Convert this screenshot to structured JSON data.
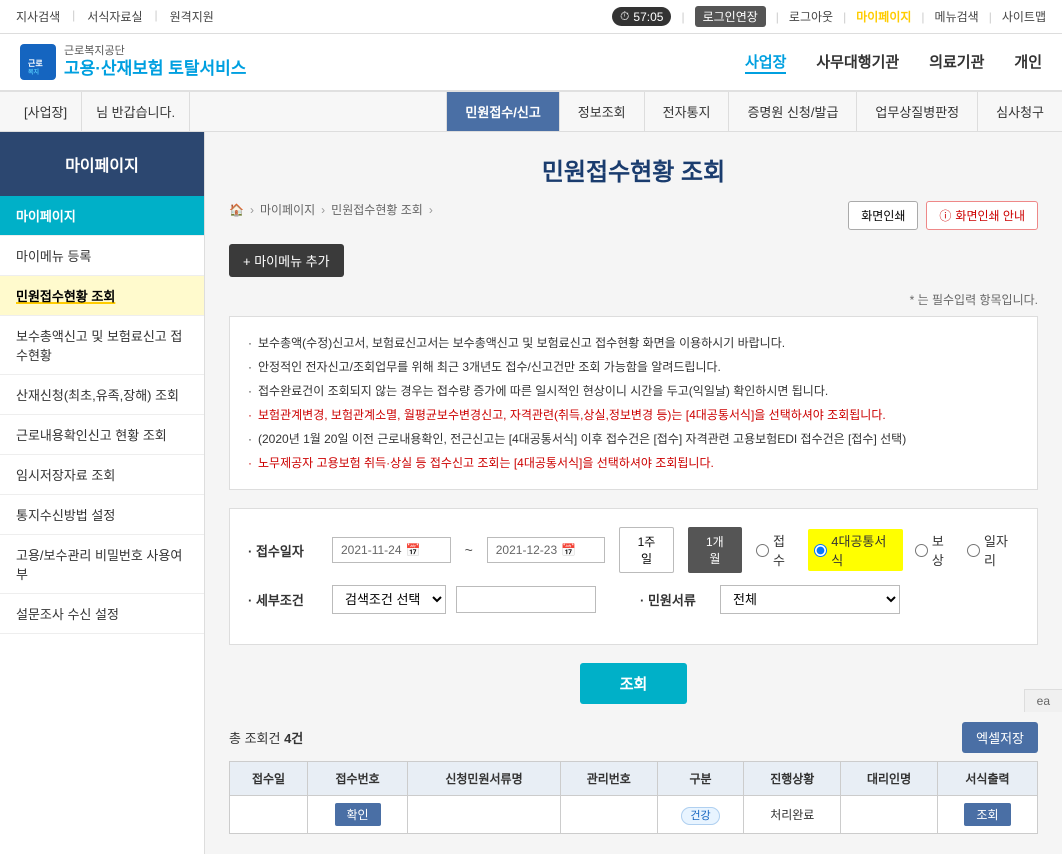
{
  "topNav": {
    "leftLinks": [
      "지사검색",
      "서식자료실",
      "원격지원"
    ],
    "timer": "57:05",
    "loginExtend": "로그인연장",
    "logout": "로그아웃",
    "mypage": "마이페이지",
    "menuSearch": "메뉴검색",
    "sitemap": "사이트맵"
  },
  "header": {
    "orgName": "근로복지공단",
    "serviceNamePart1": "고용·산재보험",
    "serviceNamePart2": "토탈서비스",
    "navItems": [
      {
        "label": "사업장",
        "active": true
      },
      {
        "label": "사무대행기관"
      },
      {
        "label": "의료기관"
      },
      {
        "label": "개인"
      }
    ]
  },
  "tabBar": {
    "label": "[사업장]",
    "user": "님 반갑습니다.",
    "tabs": [
      {
        "label": "민원접수/신고",
        "active": true
      },
      {
        "label": "정보조회"
      },
      {
        "label": "전자통지"
      },
      {
        "label": "증명원 신청/발급"
      },
      {
        "label": "업무상질병판정"
      },
      {
        "label": "심사청구"
      }
    ]
  },
  "sidebar": {
    "title": "마이페이지",
    "menuItems": [
      {
        "label": "마이페이지",
        "active": true,
        "id": "mypage"
      },
      {
        "label": "마이메뉴 등록",
        "id": "mymenu-reg"
      },
      {
        "label": "민원접수현황 조회",
        "id": "complaint-status",
        "highlight": true
      },
      {
        "label": "보수총액신고 및 보험료신고 접수현황",
        "id": "salary-report"
      },
      {
        "label": "산재신청(최초,유족,장해) 조회",
        "id": "accident-inquiry"
      },
      {
        "label": "근로내용확인신고 현황 조회",
        "id": "work-content"
      },
      {
        "label": "임시저장자료 조회",
        "id": "temp-save"
      },
      {
        "label": "통지수신방법 설정",
        "id": "notification"
      },
      {
        "label": "고용/보수관리 비밀번호 사용여부",
        "id": "password-use"
      },
      {
        "label": "설문조사 수신 설정",
        "id": "survey-settings"
      }
    ]
  },
  "content": {
    "title": "민원접수현황 조회",
    "breadcrumb": [
      "마이페이지",
      "민원접수현황 조회"
    ],
    "printBtn": "화면인쇄",
    "printNoticeBtn": "화면인쇄 안내",
    "myMenuAddBtn": "+ 마이메뉴 추가",
    "requiredNote": "* 는 필수입력 항목입니다.",
    "notices": [
      {
        "text": "보수총액(수정)신고서, 보험료신고서는 보수총액신고 및 보험료신고 접수현황 화면을 이용하시기 바랍니다.",
        "red": false
      },
      {
        "text": "안정적인 전자신고/조회업무를 위해 최근 3개년도 접수/신고건만 조회 가능함을 알려드립니다.",
        "red": false
      },
      {
        "text": "접수완료건이 조회되지 않는 경우는 접수량 증가에 따른 일시적인 현상이니 시간을 두고(익일날) 확인하시면 됩니다.",
        "red": false
      },
      {
        "text": "보험관계변경, 보험관계소멸, 월평균보수변경신고, 자격관련(취득,상실,정보변경 등)는 [4대공통서식]을 선택하셔야 조회됩니다.",
        "red": true
      },
      {
        "text": "(2020년 1월 20일 이전 근로내용확인, 전근신고는 [4대공통서식] 이후 접수건은 [접수] 자격관련 고용보험EDI 접수건은 [접수] 선택)",
        "red": false
      },
      {
        "text": "노무제공자 고용보험 취득·상실 등 접수신고 조회는 [4대공통서식]을 선택하셔야 조회됩니다.",
        "red": true
      }
    ],
    "searchForm": {
      "receptionDateLabel": "접수일자",
      "startDate": "2021-11-24",
      "endDate": "2021-12-23",
      "periodBtns": [
        "1주일",
        "1개월"
      ],
      "activePeriod": "1개월",
      "radioOptions": [
        {
          "label": "접수",
          "id": "r-receipt"
        },
        {
          "label": "4대공통서식",
          "id": "r-common",
          "highlighted": true,
          "checked": true
        },
        {
          "label": "보상",
          "id": "r-compensation"
        },
        {
          "label": "일자리",
          "id": "r-job"
        }
      ],
      "detailConditionLabel": "세부조건",
      "detailConditionPlaceholder": "검색조건 선택",
      "detailConditionOptions": [
        "검색조건 선택"
      ],
      "detailInputPlaceholder": "",
      "serviceTypeLabel": "민원서류",
      "serviceTypeDefault": "전체",
      "serviceTypeOptions": [
        "전체"
      ]
    },
    "searchBtn": "조회",
    "results": {
      "totalLabel": "총 조회건 ",
      "totalCount": "4건",
      "excelBtn": "엑셀저장",
      "tableHeaders": [
        "접수일",
        "접수번호",
        "신청민원서류명",
        "관리번호",
        "구분",
        "진행상황",
        "대리인명",
        "서식출력"
      ],
      "tableRows": [
        {
          "receptionDate": "",
          "receptionNo": "",
          "serviceName": "",
          "managementNo": "",
          "type": "건강",
          "status": "처리완료",
          "agentName": "",
          "confirmBtn": "확인",
          "lookupBtn": "조회"
        }
      ]
    }
  },
  "footer": {
    "text": "ea"
  }
}
